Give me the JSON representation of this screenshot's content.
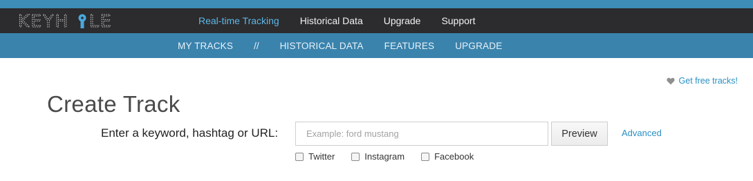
{
  "brand": {
    "logo_text": "KEYHOLE"
  },
  "topnav": {
    "items": [
      {
        "label": "Real-time Tracking",
        "active": true
      },
      {
        "label": "Historical Data"
      },
      {
        "label": "Upgrade"
      },
      {
        "label": "Support"
      }
    ]
  },
  "subnav": {
    "items": [
      "MY TRACKS",
      "HISTORICAL DATA",
      "FEATURES",
      "UPGRADE"
    ],
    "separator": "//"
  },
  "promo": {
    "icon": "heart-icon",
    "label": "Get free tracks!"
  },
  "page": {
    "title": "Create Track"
  },
  "form": {
    "prompt": "Enter a keyword, hashtag or URL:",
    "input_value": "",
    "input_placeholder": "Example: ford mustang",
    "preview_label": "Preview",
    "advanced_label": "Advanced",
    "platforms": [
      {
        "label": "Twitter",
        "checked": false
      },
      {
        "label": "Instagram",
        "checked": false
      },
      {
        "label": "Facebook",
        "checked": false
      }
    ]
  },
  "colors": {
    "top_strip": "#3d8db7",
    "top_bar": "#2c2b2d",
    "sub_bar": "#3a83ad",
    "active_nav": "#5cb8e8",
    "link": "#2a8fc3"
  }
}
